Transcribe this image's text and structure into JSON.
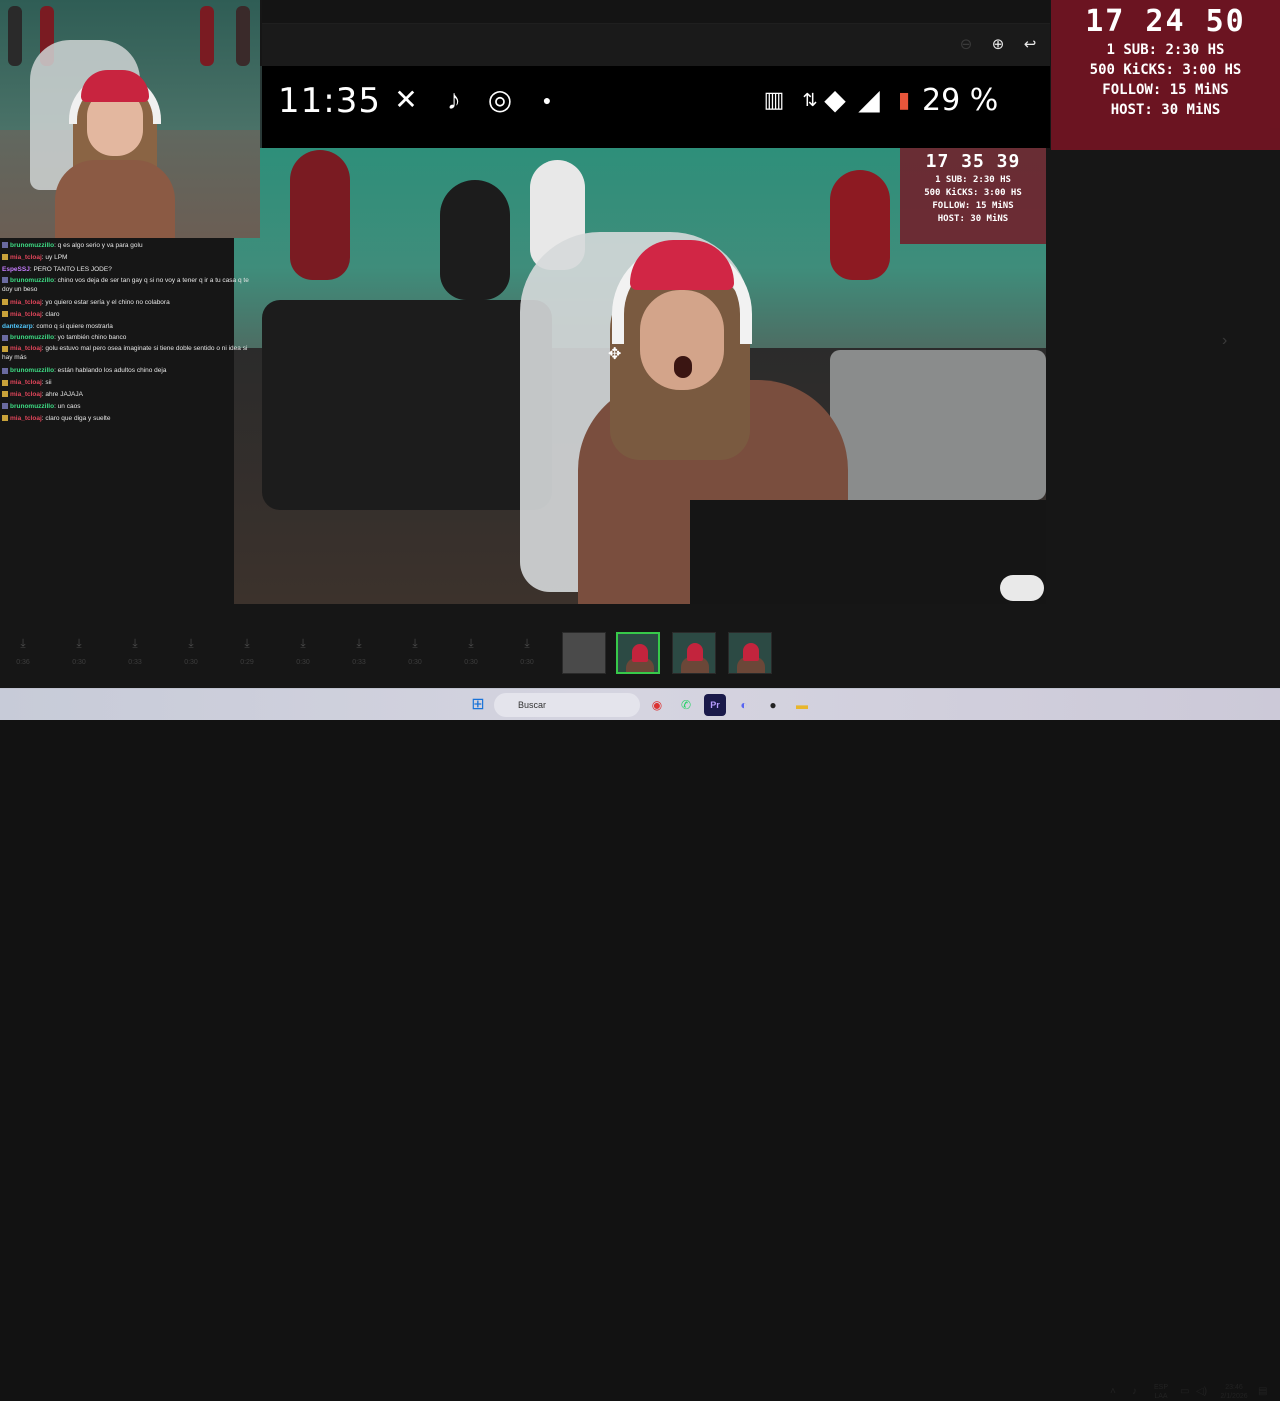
{
  "toolbar": {
    "zoom_icon": "magnifier-plus-icon",
    "back_icon": "back-arrow-icon"
  },
  "phone_status": {
    "time": "11:35",
    "battery": "29 %"
  },
  "counter_main": {
    "timer": "17 24 50",
    "lines": [
      "1 SUB: 2:30 HS",
      "500 KiCKS: 3:00 HS",
      "FOLLOW: 15 MiNS",
      "HOST: 30 MiNS"
    ]
  },
  "counter_small": {
    "timer": "17 35 39",
    "lines": [
      "1 SUB: 2:30 HS",
      "500 KiCKS: 3:00 HS",
      "FOLLOW: 15 MiNS",
      "HOST: 30 MiNS"
    ]
  },
  "chat": [
    {
      "user": "brunomuzzillo",
      "text": ": q es algo serio y va para golu",
      "color": "#3ddc84",
      "badge": "p"
    },
    {
      "user": "mia_tcloaj",
      "text": ": uy LPM",
      "color": "#e0455a",
      "badge": "y"
    },
    {
      "user": "EspeSSJ",
      "text": ": PERO TANTO LES JODE?",
      "color": "#c77dff",
      "badge": ""
    },
    {
      "user": "brunomuzzillo",
      "text": ": chino vos deja de ser tan gay q si no voy a tener q ir a tu casa q te doy un beso",
      "color": "#3ddc84",
      "badge": "p",
      "wrap": true
    },
    {
      "user": "mia_tcloaj",
      "text": ": yo quiero estar sería y el chino no colabora",
      "color": "#e0455a",
      "badge": "y"
    },
    {
      "user": "mia_tcloaj",
      "text": ": claro",
      "color": "#e0455a",
      "badge": "y"
    },
    {
      "user": "dantezarp",
      "text": ": como q si quiere mostrarla",
      "color": "#4fc3f7",
      "badge": ""
    },
    {
      "user": "brunomuzzillo",
      "text": ": yo también chino banco",
      "color": "#3ddc84",
      "badge": "p"
    },
    {
      "user": "mia_tcloaj",
      "text": ": golu estuvo mal pero osea imaginate si tiene doble sentido o ni idea si hay más",
      "color": "#e0455a",
      "badge": "y",
      "wrap": true
    },
    {
      "user": "brunomuzzillo",
      "text": ": están hablando los adultos chino deja",
      "color": "#3ddc84",
      "badge": "p"
    },
    {
      "user": "mia_tcloaj",
      "text": ": sii",
      "color": "#e0455a",
      "badge": "y"
    },
    {
      "user": "mia_tcloaj",
      "text": ": ahre JAJAJA",
      "color": "#e0455a",
      "badge": "y"
    },
    {
      "user": "brunomuzzillo",
      "text": ": un caos",
      "color": "#3ddc84",
      "badge": "p"
    },
    {
      "user": "mia_tcloaj",
      "text": ": claro que diga y suelte",
      "color": "#e0455a",
      "badge": "y"
    }
  ],
  "filmstrip": {
    "download_labels": [
      "0:36",
      "0:30",
      "0:33",
      "0:30",
      "0:29",
      "0:30",
      "0:33",
      "0:30",
      "0:30",
      "0:30"
    ]
  },
  "taskbar": {
    "search_placeholder": "Buscar",
    "lang": "ESP",
    "layout": "LAA",
    "time": "23:46",
    "date": "2/1/2026"
  },
  "colors": {
    "selected_thumb": "#37c94a",
    "counter_bg": "#78142a"
  }
}
